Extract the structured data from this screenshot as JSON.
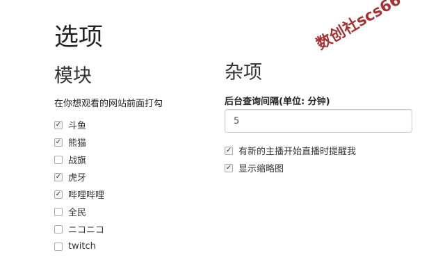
{
  "page": {
    "title": "选项"
  },
  "modules": {
    "title": "模块",
    "hint": "在你想观看的网站前面打勾",
    "sites": [
      {
        "label": "斗鱼",
        "checked": true
      },
      {
        "label": "熊猫",
        "checked": true
      },
      {
        "label": "战旗",
        "checked": false
      },
      {
        "label": "虎牙",
        "checked": true
      },
      {
        "label": "哔哩哔哩",
        "checked": true
      },
      {
        "label": "全民",
        "checked": false
      },
      {
        "label": "ニコニコ",
        "checked": false
      },
      {
        "label": "twitch",
        "checked": false
      }
    ]
  },
  "misc": {
    "title": "杂项",
    "interval_label": "后台查询间隔(单位: 分钟)",
    "interval_value": "5",
    "options": [
      {
        "label": "有新的主播开始直播时提醒我",
        "checked": true
      },
      {
        "label": "显示缩略图",
        "checked": true
      }
    ]
  },
  "watermark": {
    "text": "数创社scs66",
    "color": "#9b1c1c"
  }
}
